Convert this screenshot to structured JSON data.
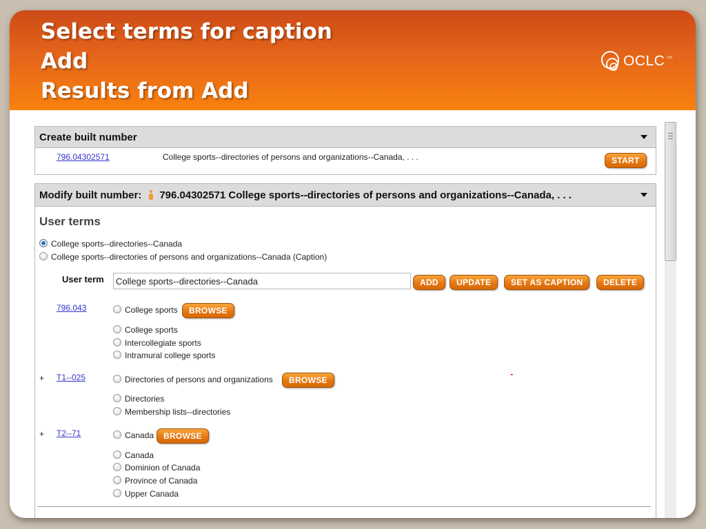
{
  "slide": {
    "title_lines": [
      "Select terms for caption",
      "Add",
      "Results from Add"
    ],
    "logo": {
      "text": "OCLC",
      "trademark": "TM"
    }
  },
  "create_panel": {
    "header": "Create built number",
    "number_link": "796.04302571",
    "description": "College sports--directories of persons and organizations--Canada, . . .",
    "start_button": "START"
  },
  "modify_panel": {
    "header_label": "Modify built number:",
    "header_value": "796.04302571 College sports--directories of persons and organizations--Canada, . . .",
    "user_terms_heading": "User terms",
    "user_terms": [
      {
        "label": "College sports--directories--Canada",
        "selected": true
      },
      {
        "label": "College sports--directories of persons and organizations--Canada  (Caption)",
        "selected": false
      }
    ],
    "user_term_label": "User term",
    "user_term_value": "College sports--directories--Canada",
    "buttons": {
      "add": "ADD",
      "update": "UPDATE",
      "set_caption": "SET AS CAPTION",
      "delete": "DELETE"
    },
    "browse_label": "BROWSE",
    "marker": "-",
    "components": [
      {
        "expander": "",
        "number": "796.043",
        "heading": "College sports",
        "terms": [
          "College sports",
          "Intercollegiate sports",
          "Intramural college sports"
        ]
      },
      {
        "expander": "+",
        "number": "T1--025",
        "heading": "Directories of persons and organizations",
        "terms": [
          "Directories",
          "Membership lists--directories"
        ]
      },
      {
        "expander": "+",
        "number": "T2--71",
        "heading": "Canada",
        "terms": [
          "Canada",
          "Dominion of Canada",
          "Province of Canada",
          "Upper Canada"
        ]
      }
    ]
  },
  "colors": {
    "accent": "#e47510",
    "banner_top": "#cd4b17",
    "banner_bottom": "#f9820f",
    "link": "#3333cc"
  }
}
